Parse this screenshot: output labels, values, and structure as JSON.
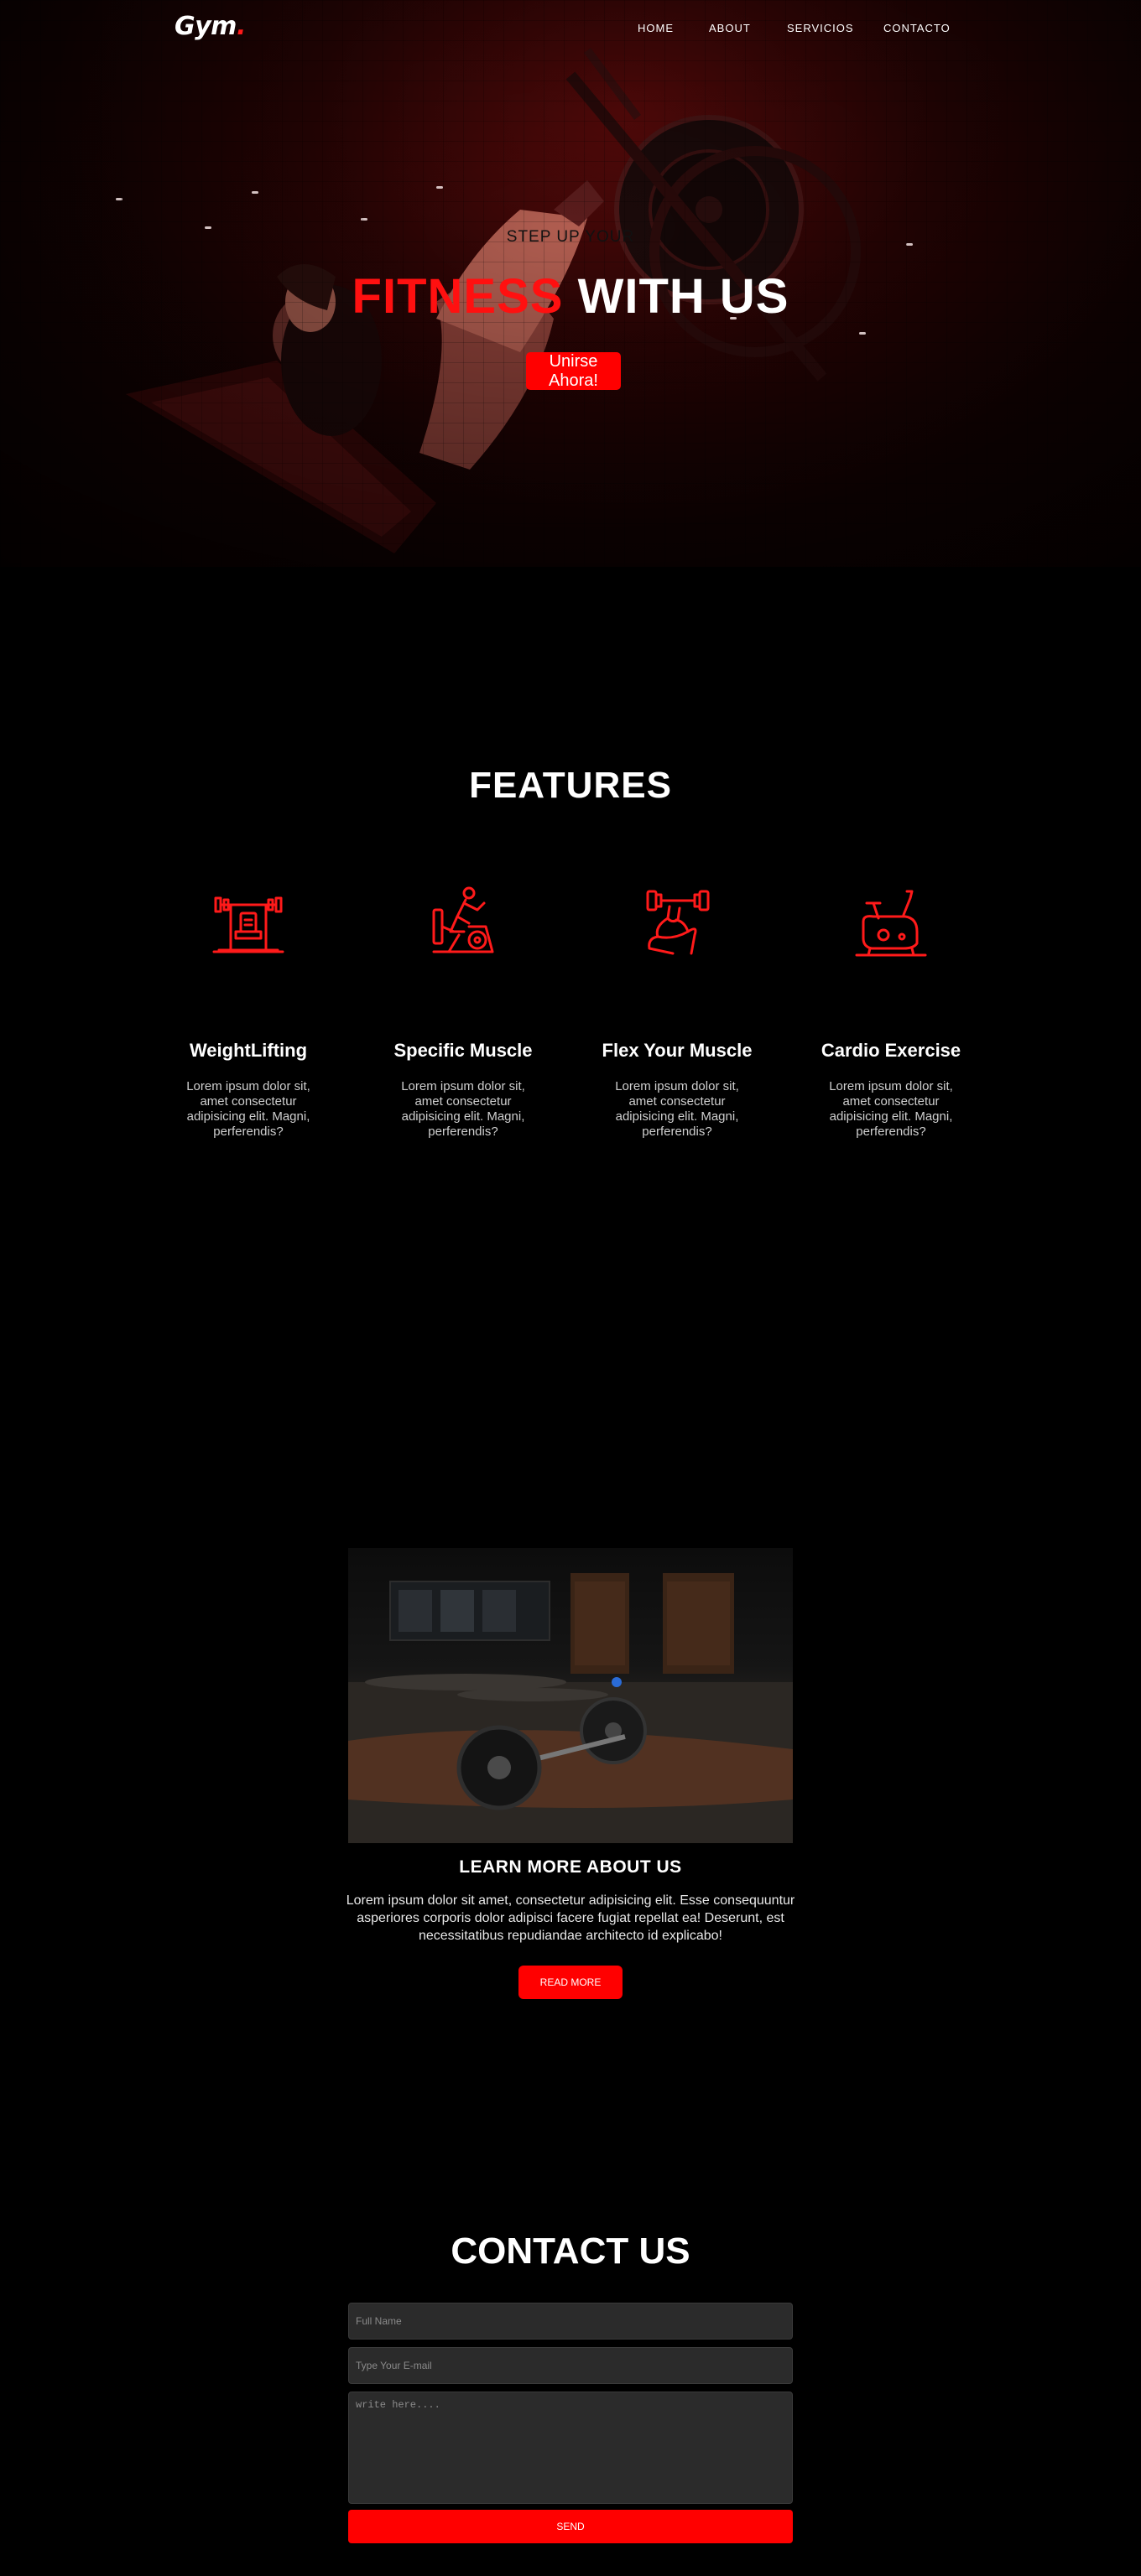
{
  "brand": {
    "logo_text": "Gym",
    "logo_dot": ".",
    "accent": "#ff0000"
  },
  "nav": {
    "items": [
      {
        "label": "HOME"
      },
      {
        "label": "ABOUT"
      },
      {
        "label": "SERVICIOS"
      },
      {
        "label": "CONTACTO"
      }
    ]
  },
  "hero": {
    "subtitle": "STEP UP YOUR",
    "title_highlight": "FITNESS",
    "title_rest": "WITH US",
    "button_label": "Unirse Ahora!"
  },
  "features": {
    "title": "FEATURES",
    "items": [
      {
        "icon": "weightlifting-icon",
        "name": "WeightLifting",
        "desc": "Lorem ipsum dolor sit, amet consectetur adipisicing elit. Magni, perferendis?"
      },
      {
        "icon": "muscle-machine-icon",
        "name": "Specific Muscle",
        "desc": "Lorem ipsum dolor sit, amet consectetur adipisicing elit. Magni, perferendis?"
      },
      {
        "icon": "flex-muscle-icon",
        "name": "Flex Your Muscle",
        "desc": "Lorem ipsum dolor sit, amet consectetur adipisicing elit. Magni, perferendis?"
      },
      {
        "icon": "exercise-bike-icon",
        "name": "Cardio Exercise",
        "desc": "Lorem ipsum dolor sit, amet consectetur adipisicing elit. Magni, perferendis?"
      }
    ]
  },
  "about": {
    "title": "LEARN MORE ABOUT US",
    "description": "Lorem ipsum dolor sit amet, consectetur adipisicing elit. Esse consequuntur asperiores corporis dolor adipisci facere fugiat repellat ea! Deserunt, est necessitatibus repudiandae architecto id explicabo!",
    "button_label": "READ MORE"
  },
  "contact": {
    "title": "CONTACT US",
    "name_placeholder": "Full Name",
    "email_placeholder": "Type Your E-mail",
    "message_placeholder": "write here....",
    "send_label": "SEND"
  }
}
